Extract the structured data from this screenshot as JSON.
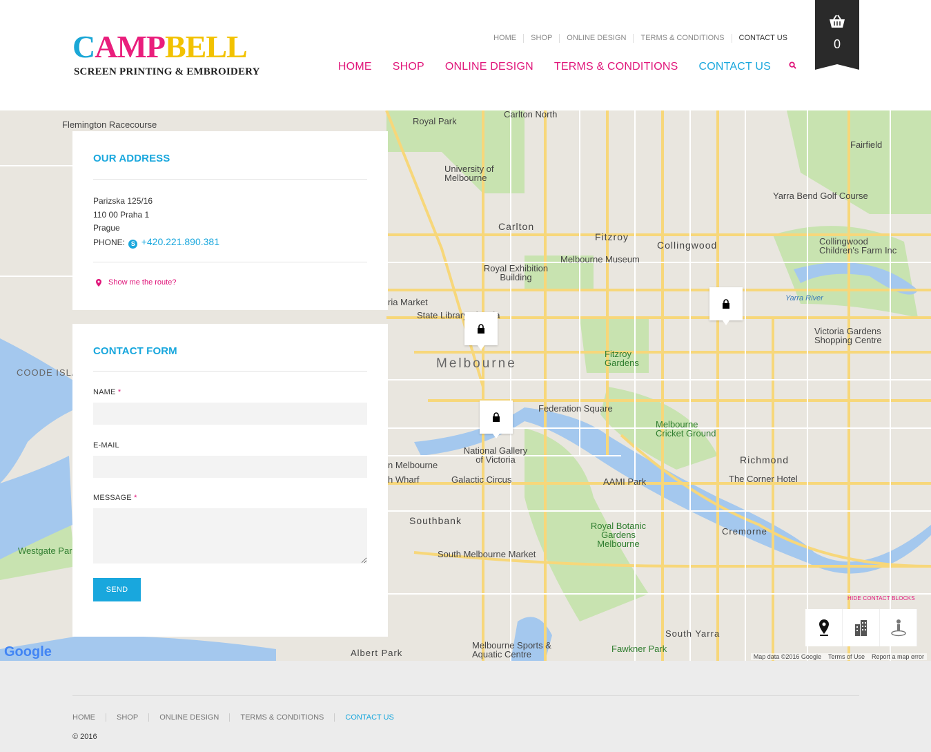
{
  "header": {
    "logo": {
      "main_part1": "C",
      "main_part2": "AMP",
      "main_part3": "BELL",
      "subtitle": "SCREEN PRINTING & EMBROIDERY"
    },
    "top_nav": [
      {
        "label": "HOME"
      },
      {
        "label": "SHOP"
      },
      {
        "label": "ONLINE DESIGN"
      },
      {
        "label": "TERMS & CONDITIONS"
      },
      {
        "label": "CONTACT US"
      }
    ],
    "main_nav": [
      {
        "label": "HOME"
      },
      {
        "label": "SHOP"
      },
      {
        "label": "ONLINE DESIGN"
      },
      {
        "label": "TERMS & CONDITIONS"
      },
      {
        "label": "CONTACT US"
      }
    ],
    "cart_count": "0"
  },
  "map": {
    "labels": {
      "flemington": "Flemington Racecourse",
      "royal_park": "Royal Park",
      "carlton_north": "Carlton North",
      "fairfield": "Fairfield",
      "uni": "University of Melbourne",
      "carlton": "Carlton",
      "fitzroy": "Fitzroy",
      "collingwood": "Collingwood",
      "yarra_bend": "Yarra Bend Golf Course",
      "childrens_farm": "Collingwood Children's Farm Inc",
      "museum": "Melbourne Museum",
      "exhibition": "Royal Exhibition Building",
      "state_library": "State Library Victoria",
      "queen_vic": "ria Market",
      "melbourne": "Melbourne",
      "fitzroy_gardens": "Fitzroy Gardens",
      "victoria_gardens": "Victoria Gardens Shopping Centre",
      "yarra_river": "Yarra River",
      "federation": "Federation Square",
      "mcg": "Melbourne Cricket Ground",
      "richmond": "Richmond",
      "ngv": "National Gallery of Victoria",
      "galactic": "Galactic Circus",
      "aami": "AAMI Park",
      "corner_hotel": "The Corner Hotel",
      "southbank": "Southbank",
      "botanic": "Royal Botanic Gardens Melbourne",
      "cremorne": "Cremorne",
      "south_market": "South Melbourne Market",
      "south_yarra": "South Yarra",
      "fawkner": "Fawkner Park",
      "albert_park": "Albert Park",
      "sports": "Melbourne Sports & Aquatic Centre",
      "coode": "COODE ISLA",
      "westgate": "Westgate Par",
      "whart": "h Wharf",
      "n_melbourne": "n Melbourne"
    },
    "hide_blocks": "HIDE CONTACT BLOCKS",
    "footer": {
      "data": "Map data ©2016 Google",
      "terms": "Terms of Use",
      "report": "Report a map error"
    },
    "google": "Google"
  },
  "address": {
    "title": "OUR ADDRESS",
    "line1": "Parizska 125/16",
    "line2": "110 00 Praha 1",
    "line3": "Prague",
    "phone_label": "PHONE:",
    "phone_value": "+420.221.890.381",
    "route_label": "Show me the route?"
  },
  "contact_form": {
    "title": "CONTACT FORM",
    "name_label": "NAME",
    "email_label": "E-MAIL",
    "message_label": "MESSAGE",
    "required_mark": "*",
    "send_label": "SEND"
  },
  "footer": {
    "nav": [
      {
        "label": "HOME"
      },
      {
        "label": "SHOP"
      },
      {
        "label": "ONLINE DESIGN"
      },
      {
        "label": "TERMS & CONDITIONS"
      },
      {
        "label": "CONTACT US"
      }
    ],
    "copyright": "© 2016"
  },
  "colors": {
    "accent_pink": "#e0167a",
    "accent_blue": "#19a7dd",
    "cart_bg": "#2a2a2a"
  }
}
